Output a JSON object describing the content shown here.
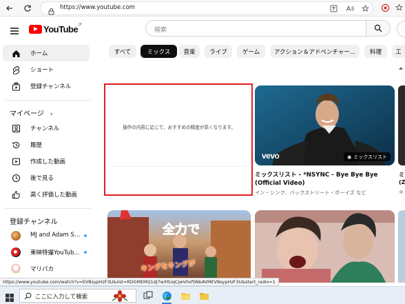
{
  "browser": {
    "url": "https://www.youtube.com"
  },
  "header": {
    "logo_text": "YouTube",
    "logo_region": "JP",
    "search_placeholder": "検索"
  },
  "sidebar": {
    "main_items": [
      {
        "label": "ホーム",
        "icon": "home-icon",
        "active": true
      },
      {
        "label": "ショート",
        "icon": "shorts-icon"
      },
      {
        "label": "登録チャンネル",
        "icon": "subscriptions-icon"
      }
    ],
    "you_section_title": "マイページ",
    "you_items": [
      {
        "label": "チャンネル",
        "icon": "channel-icon"
      },
      {
        "label": "履歴",
        "icon": "history-icon"
      },
      {
        "label": "作成した動画",
        "icon": "your-videos-icon"
      },
      {
        "label": "後で見る",
        "icon": "watch-later-icon"
      },
      {
        "label": "高く評価した動画",
        "icon": "liked-icon"
      }
    ],
    "subs_section_title": "登録チャンネル",
    "subscriptions": [
      {
        "label": "MJ and Adam Sh...",
        "new": true
      },
      {
        "label": "東映特撮YouTub...",
        "new": true
      },
      {
        "label": "マリパカ",
        "new": false
      }
    ]
  },
  "chips": [
    {
      "label": "すべて",
      "active": false
    },
    {
      "label": "ミックス",
      "active": true
    },
    {
      "label": "音楽",
      "active": false
    },
    {
      "label": "ライブ",
      "active": false
    },
    {
      "label": "ゲーム",
      "active": false
    },
    {
      "label": "アクション＆アドベンチャー...",
      "active": false
    },
    {
      "label": "料理",
      "active": false
    },
    {
      "label": "工",
      "active": false
    }
  ],
  "feed": {
    "empty_card_text": "操作の内容に応じて、おすすめの精度が高くなります。",
    "video1": {
      "title": "ミックスリスト - *NSYNC - Bye Bye Bye (Official Video)",
      "subtitle": "イン・シンク、バックストリート・ボーイズ など",
      "badge": "ミックスリスト",
      "watermark": "vevo"
    },
    "video2": {
      "caption": "キングをキングが"
    },
    "edge_label_1": "ミ",
    "edge_label_2": "(Z",
    "edge_label_3": "キ"
  },
  "status_url": "https://www.youtube.com/watch?v=EVBsypHzF3U&list=RDGMEMQ1dJ7wXfLlqCjwV0xfSNbAVMEVBsypHzF3U&start_radio=1",
  "taskbar": {
    "search_text": "ここに入力して検索"
  },
  "colors": {
    "youtube_red": "#ff0000",
    "highlight_box": "#e11d1d",
    "chip_active": "#0f0f0f",
    "chip_bg": "#f0f0f0",
    "new_dot": "#3ea6ff"
  }
}
